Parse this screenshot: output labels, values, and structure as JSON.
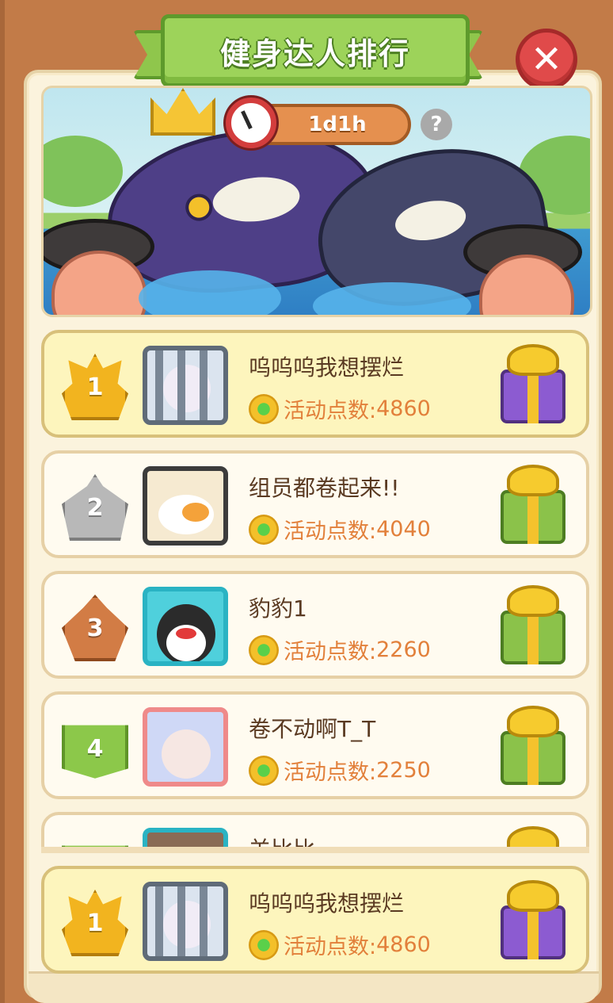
{
  "title": "健身达人排行",
  "close_label": "✕",
  "timer": "1d1h",
  "help_label": "?",
  "score_label": "活动点数:",
  "rows": [
    {
      "rank": "1",
      "name": "呜呜呜我想摆烂",
      "score": "4860",
      "badge": "gold",
      "avatar": "cage",
      "gift": "purple"
    },
    {
      "rank": "2",
      "name": "组员都卷起来!!",
      "score": "4040",
      "badge": "silver",
      "avatar": "duck",
      "gift": "green"
    },
    {
      "rank": "3",
      "name": "豹豹1",
      "score": "2260",
      "badge": "bronze",
      "avatar": "penguin",
      "gift": "green"
    },
    {
      "rank": "4",
      "name": "卷不动啊T_T",
      "score": "2250",
      "badge": "green",
      "avatar": "girl",
      "gift": "green"
    },
    {
      "rank": "",
      "name": "羊比比",
      "score": "",
      "badge": "green",
      "avatar": "girl",
      "gift": "green"
    }
  ],
  "my_row": {
    "rank": "1",
    "name": "呜呜呜我想摆烂",
    "score": "4860"
  },
  "colors": {
    "banner_green": "#9dd35a",
    "close_red": "#e04a4a",
    "score_orange": "#e2803b",
    "my_row_bg": "#fdf5bd"
  }
}
